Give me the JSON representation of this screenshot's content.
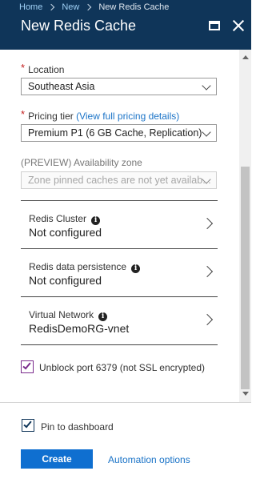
{
  "breadcrumb": {
    "items": [
      "Home",
      "New",
      "New Redis Cache"
    ]
  },
  "header": {
    "title": "New Redis Cache",
    "maximize_icon": "maximize-icon",
    "close_icon": "close-icon"
  },
  "form": {
    "location": {
      "required_mark": "*",
      "label": "Location",
      "value": "Southeast Asia"
    },
    "pricing_tier": {
      "required_mark": "*",
      "label": "Pricing tier",
      "link": "(View full pricing details)",
      "value": "Premium P1 (6 GB Cache, Replication)"
    },
    "availability_zone": {
      "label": "(PREVIEW) Availability zone",
      "value": "Zone pinned caches are not yet availab..."
    },
    "redis_cluster": {
      "label": "Redis Cluster",
      "value": "Not configured"
    },
    "data_persistence": {
      "label": "Redis data persistence",
      "value": "Not configured"
    },
    "virtual_network": {
      "label": "Virtual Network",
      "value": "RedisDemoRG-vnet"
    },
    "unblock_port": {
      "label": "Unblock port 6379 (not SSL encrypted)",
      "checked": true
    }
  },
  "footer": {
    "pin_label": "Pin to dashboard",
    "pin_checked": true,
    "create_label": "Create",
    "automation_label": "Automation options"
  },
  "colors": {
    "header_bg": "#0f3559",
    "primary_button": "#0f6fd0",
    "link": "#1a73c7",
    "required": "#c41e1e",
    "checkbox_focus": "#7a2a8c"
  }
}
